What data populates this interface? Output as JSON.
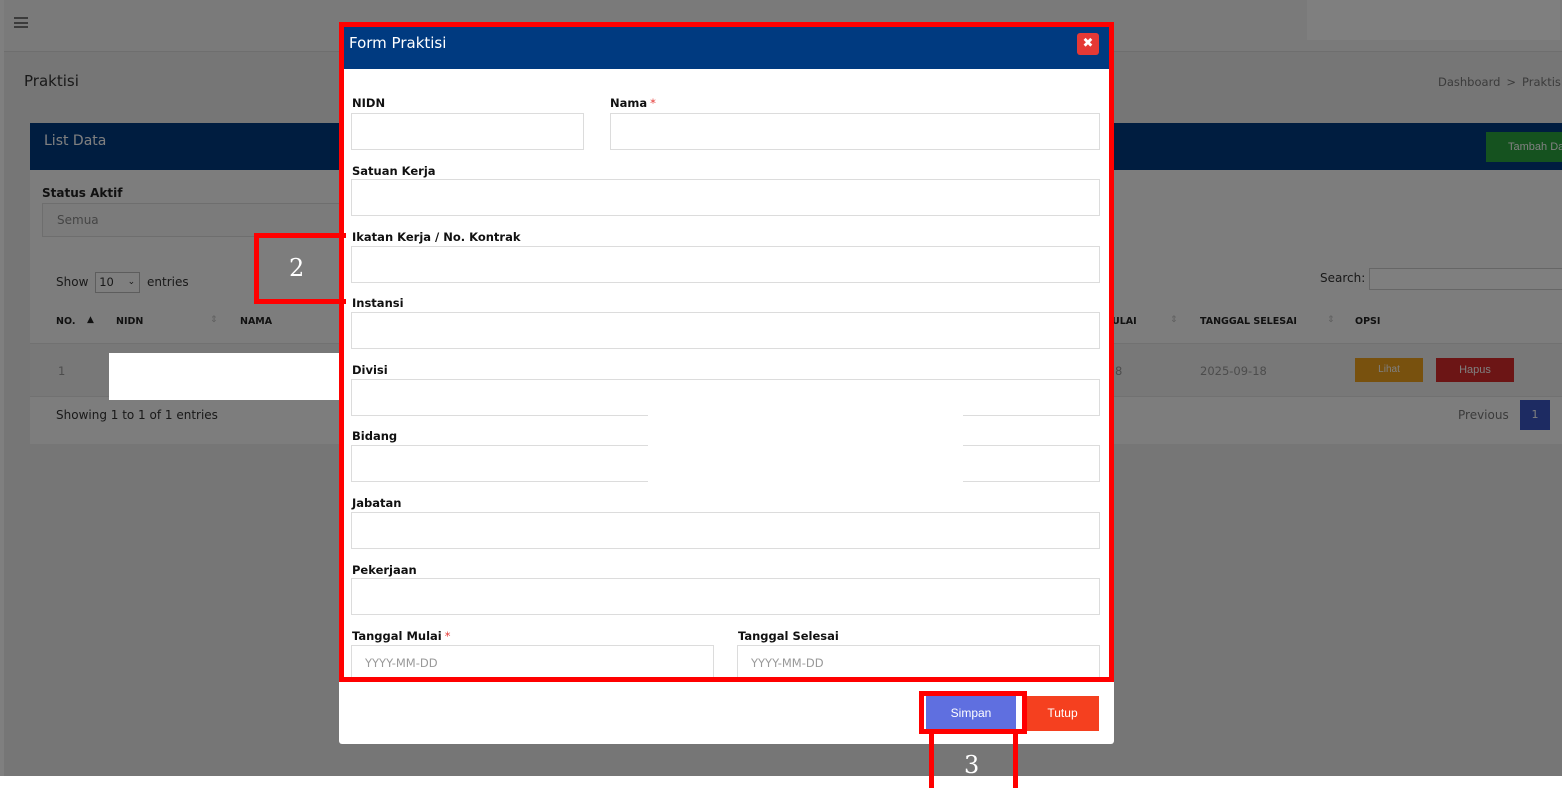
{
  "header": {
    "menu_icon": "hamburger-menu-icon"
  },
  "page": {
    "title": "Praktisi",
    "breadcrumb": [
      "Dashboard",
      ">",
      "Praktisi"
    ]
  },
  "card": {
    "title": "List Data",
    "add_button": "Tambah Data",
    "status_filter": {
      "label": "Status Aktif",
      "value": "Semua"
    },
    "show": {
      "prefix": "Show",
      "value": "10",
      "suffix": "entries"
    },
    "search_label": "Search:",
    "columns": [
      "NO.",
      "NIDN",
      "NAMA",
      "ULAI",
      "TANGGAL SELESAI",
      "OPSI"
    ],
    "row": {
      "no": "1",
      "tanggal_mulai_partial": "8",
      "tanggal_selesai": "2025-09-18",
      "lihat": "Lihat",
      "hapus": "Hapus"
    },
    "showing": "Showing 1 to 1 of 1 entries",
    "previous": "Previous",
    "page": "1"
  },
  "modal": {
    "title": "Form Praktisi",
    "close_icon": "close-x-icon",
    "required_mark": "*",
    "fields": {
      "nidn": "NIDN",
      "nama": "Nama",
      "satuan_kerja": "Satuan Kerja",
      "ikatan_kerja": "Ikatan Kerja / No. Kontrak",
      "instansi": "Instansi",
      "divisi": "Divisi",
      "bidang": "Bidang",
      "jabatan": "Jabatan",
      "pekerjaan": "Pekerjaan",
      "tanggal_mulai": "Tanggal Mulai",
      "tanggal_selesai": "Tanggal Selesai"
    },
    "date_placeholder": "YYYY-MM-DD",
    "save_button": "Simpan",
    "close_button": "Tutup"
  },
  "annotations": {
    "marker_2": "2",
    "marker_3": "3",
    "color": "#ff0000"
  },
  "colors": {
    "primary": "#003a80",
    "success": "#2aa53f",
    "warning": "#f0a21d",
    "danger": "#d92b2b",
    "save": "#5f6fe0",
    "close": "#f5401f"
  }
}
